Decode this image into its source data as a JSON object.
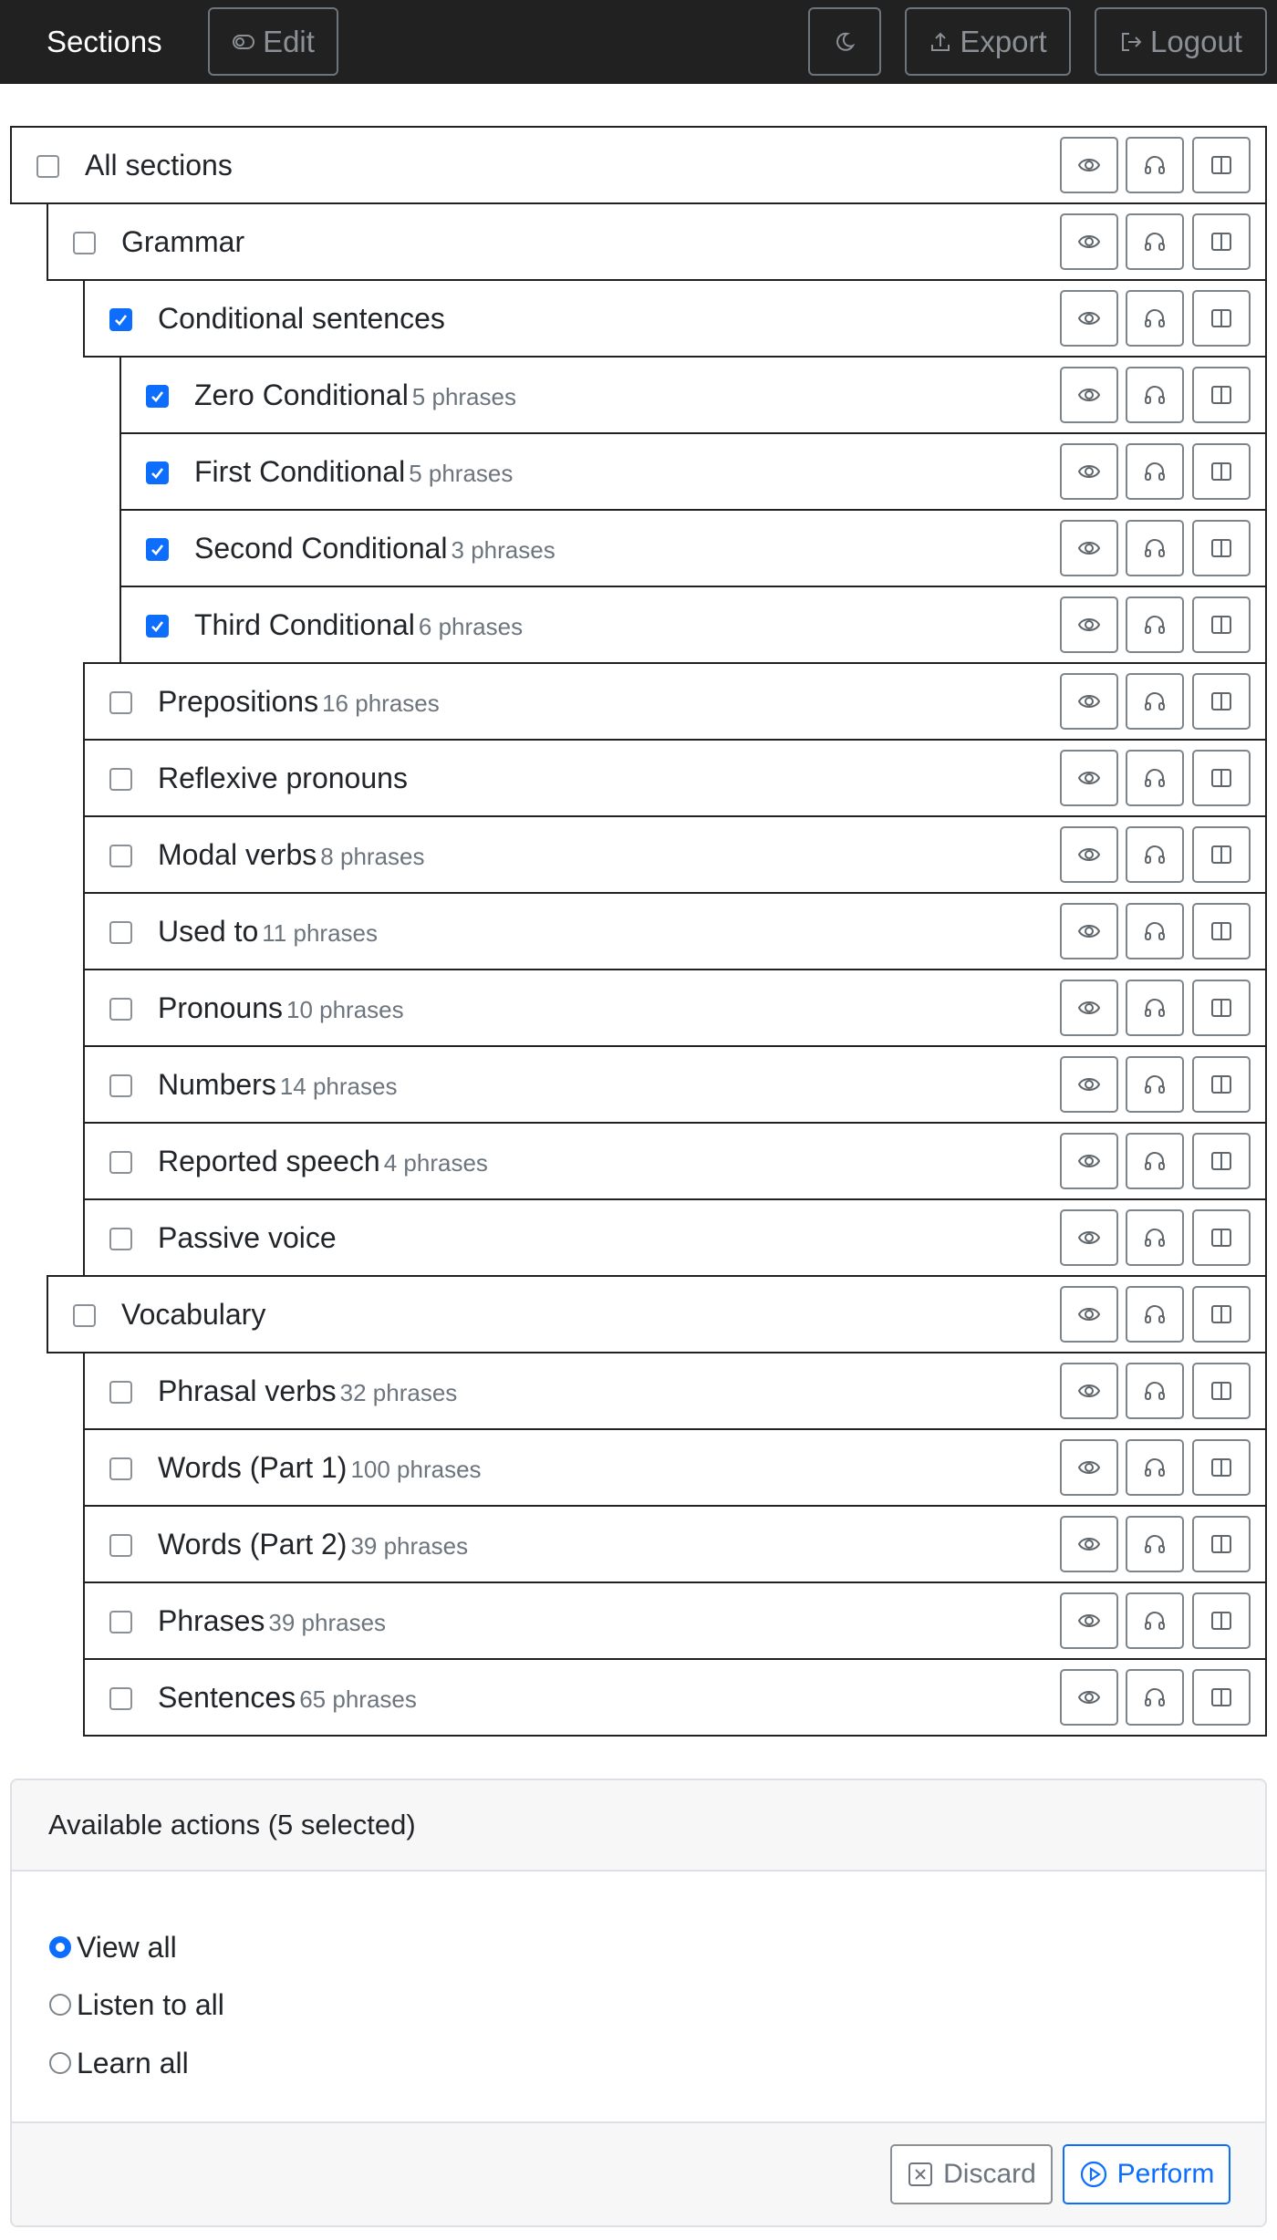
{
  "navbar": {
    "brand": "Sections",
    "edit_label": "Edit",
    "export_label": "Export",
    "logout_label": "Logout"
  },
  "tree": [
    {
      "label": "All sections",
      "count": "",
      "checked": false,
      "level": 0
    },
    {
      "label": "Grammar",
      "count": "",
      "checked": false,
      "level": 1
    },
    {
      "label": "Conditional sentences",
      "count": "",
      "checked": true,
      "level": 2
    },
    {
      "label": "Zero Conditional",
      "count": "5 phrases",
      "checked": true,
      "level": 3
    },
    {
      "label": "First Conditional",
      "count": "5 phrases",
      "checked": true,
      "level": 3
    },
    {
      "label": "Second Conditional",
      "count": "3 phrases",
      "checked": true,
      "level": 3
    },
    {
      "label": "Third Conditional",
      "count": "6 phrases",
      "checked": true,
      "level": 3
    },
    {
      "label": "Prepositions",
      "count": "16 phrases",
      "checked": false,
      "level": 2
    },
    {
      "label": "Reflexive pronouns",
      "count": "",
      "checked": false,
      "level": 2
    },
    {
      "label": "Modal verbs",
      "count": "8 phrases",
      "checked": false,
      "level": 2
    },
    {
      "label": "Used to",
      "count": "11 phrases",
      "checked": false,
      "level": 2
    },
    {
      "label": "Pronouns",
      "count": "10 phrases",
      "checked": false,
      "level": 2
    },
    {
      "label": "Numbers",
      "count": "14 phrases",
      "checked": false,
      "level": 2
    },
    {
      "label": "Reported speech",
      "count": "4 phrases",
      "checked": false,
      "level": 2
    },
    {
      "label": "Passive voice",
      "count": "",
      "checked": false,
      "level": 2
    },
    {
      "label": "Vocabulary",
      "count": "",
      "checked": false,
      "level": 1
    },
    {
      "label": "Phrasal verbs",
      "count": "32 phrases",
      "checked": false,
      "level": 2
    },
    {
      "label": "Words (Part 1)",
      "count": "100 phrases",
      "checked": false,
      "level": 2
    },
    {
      "label": "Words (Part 2)",
      "count": "39 phrases",
      "checked": false,
      "level": 2
    },
    {
      "label": "Phrases",
      "count": "39 phrases",
      "checked": false,
      "level": 2
    },
    {
      "label": "Sentences",
      "count": "65 phrases",
      "checked": false,
      "level": 2
    }
  ],
  "row_actions": [
    "eye-icon",
    "headphones-icon",
    "split-view-icon"
  ],
  "actions_card": {
    "title": "Available actions (5 selected)",
    "options": [
      {
        "label": "View all",
        "selected": true
      },
      {
        "label": "Listen to all",
        "selected": false
      },
      {
        "label": "Learn all",
        "selected": false
      }
    ],
    "discard_label": "Discard",
    "perform_label": "Perform"
  },
  "colors": {
    "navbar_bg": "#212121",
    "primary": "#0d6efd",
    "muted": "#6c757d"
  }
}
